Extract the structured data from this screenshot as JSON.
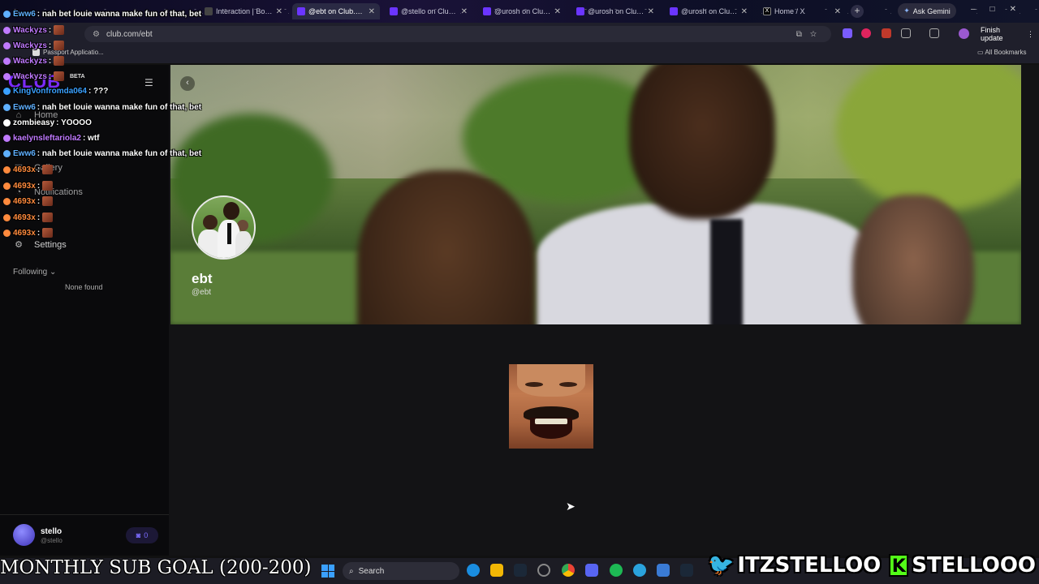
{
  "browser": {
    "tabs": [
      {
        "label": "Interaction | BotRi",
        "active": false
      },
      {
        "label": "@ebt on Club.com",
        "active": true
      },
      {
        "label": "@stello on Club.co",
        "active": false
      },
      {
        "label": "@urosh on Club.co",
        "active": false
      },
      {
        "label": "@urosh on Club.co",
        "active": false
      },
      {
        "label": "@urosh on Club.co",
        "active": false
      },
      {
        "label": "Home / X",
        "active": false
      }
    ],
    "gemini_label": "Ask Gemini",
    "url": "club.com/ebt",
    "finish_update_label": "Finish update",
    "bookmarks": {
      "passport": "Passport Applicatio...",
      "all": "All Bookmarks"
    }
  },
  "app": {
    "logo": "CLUB",
    "beta": "BETA",
    "nav": {
      "home": "Home",
      "gallery": "Gallery",
      "notifications": "Notifications",
      "settings": "Settings"
    },
    "following_label": "Following",
    "none_found": "None found",
    "user": {
      "name": "stello",
      "handle": "@stello",
      "coins": "0"
    }
  },
  "profile": {
    "name": "ebt",
    "handle": "@ebt"
  },
  "chat": [
    {
      "user": "Eww6",
      "msg": ": nah bet louie wanna make fun of that, bet",
      "color": "#5fb0ff"
    },
    {
      "user": "Wackyzs",
      "msg": ":",
      "color": "#c07aff"
    },
    {
      "user": "Wackyzs",
      "msg": ":",
      "color": "#c07aff"
    },
    {
      "user": "Wackyzs",
      "msg": ":",
      "color": "#c07aff"
    },
    {
      "user": "Wackyzs",
      "msg": ":",
      "color": "#c07aff"
    },
    {
      "user": "KingVonfromda064",
      "msg": ": ???",
      "color": "#3aa0ff"
    },
    {
      "user": "Eww6",
      "msg": ": nah bet louie wanna make fun of that, bet",
      "color": "#5fb0ff"
    },
    {
      "user": "zombieasy",
      "msg": ": YOOOO",
      "color": "#ffffff"
    },
    {
      "user": "kaelynsleftariola2",
      "msg": ": wtf",
      "color": "#c07aff"
    },
    {
      "user": "Eww6",
      "msg": ": nah bet louie wanna make fun of that, bet",
      "color": "#5fb0ff"
    },
    {
      "user": "4693x",
      "msg": ":",
      "color": "#ff8a3d"
    },
    {
      "user": "4693x",
      "msg": ":",
      "color": "#ff8a3d"
    },
    {
      "user": "4693x",
      "msg": ":",
      "color": "#ff8a3d"
    },
    {
      "user": "4693x",
      "msg": ":",
      "color": "#ff8a3d"
    },
    {
      "user": "4693x",
      "msg": ":",
      "color": "#ff8a3d"
    }
  ],
  "stream": {
    "sub_goal": "MONTHLY SUB GOAL (200-200)",
    "twitter": "ITZSTELLOO",
    "kick_letter": "K",
    "kick": "STELLOOO"
  },
  "taskbar": {
    "search_label": "Search"
  },
  "colors": {
    "accent": "#7b2bff",
    "twitter": "#1d9bf0",
    "kick": "#53fc18"
  }
}
